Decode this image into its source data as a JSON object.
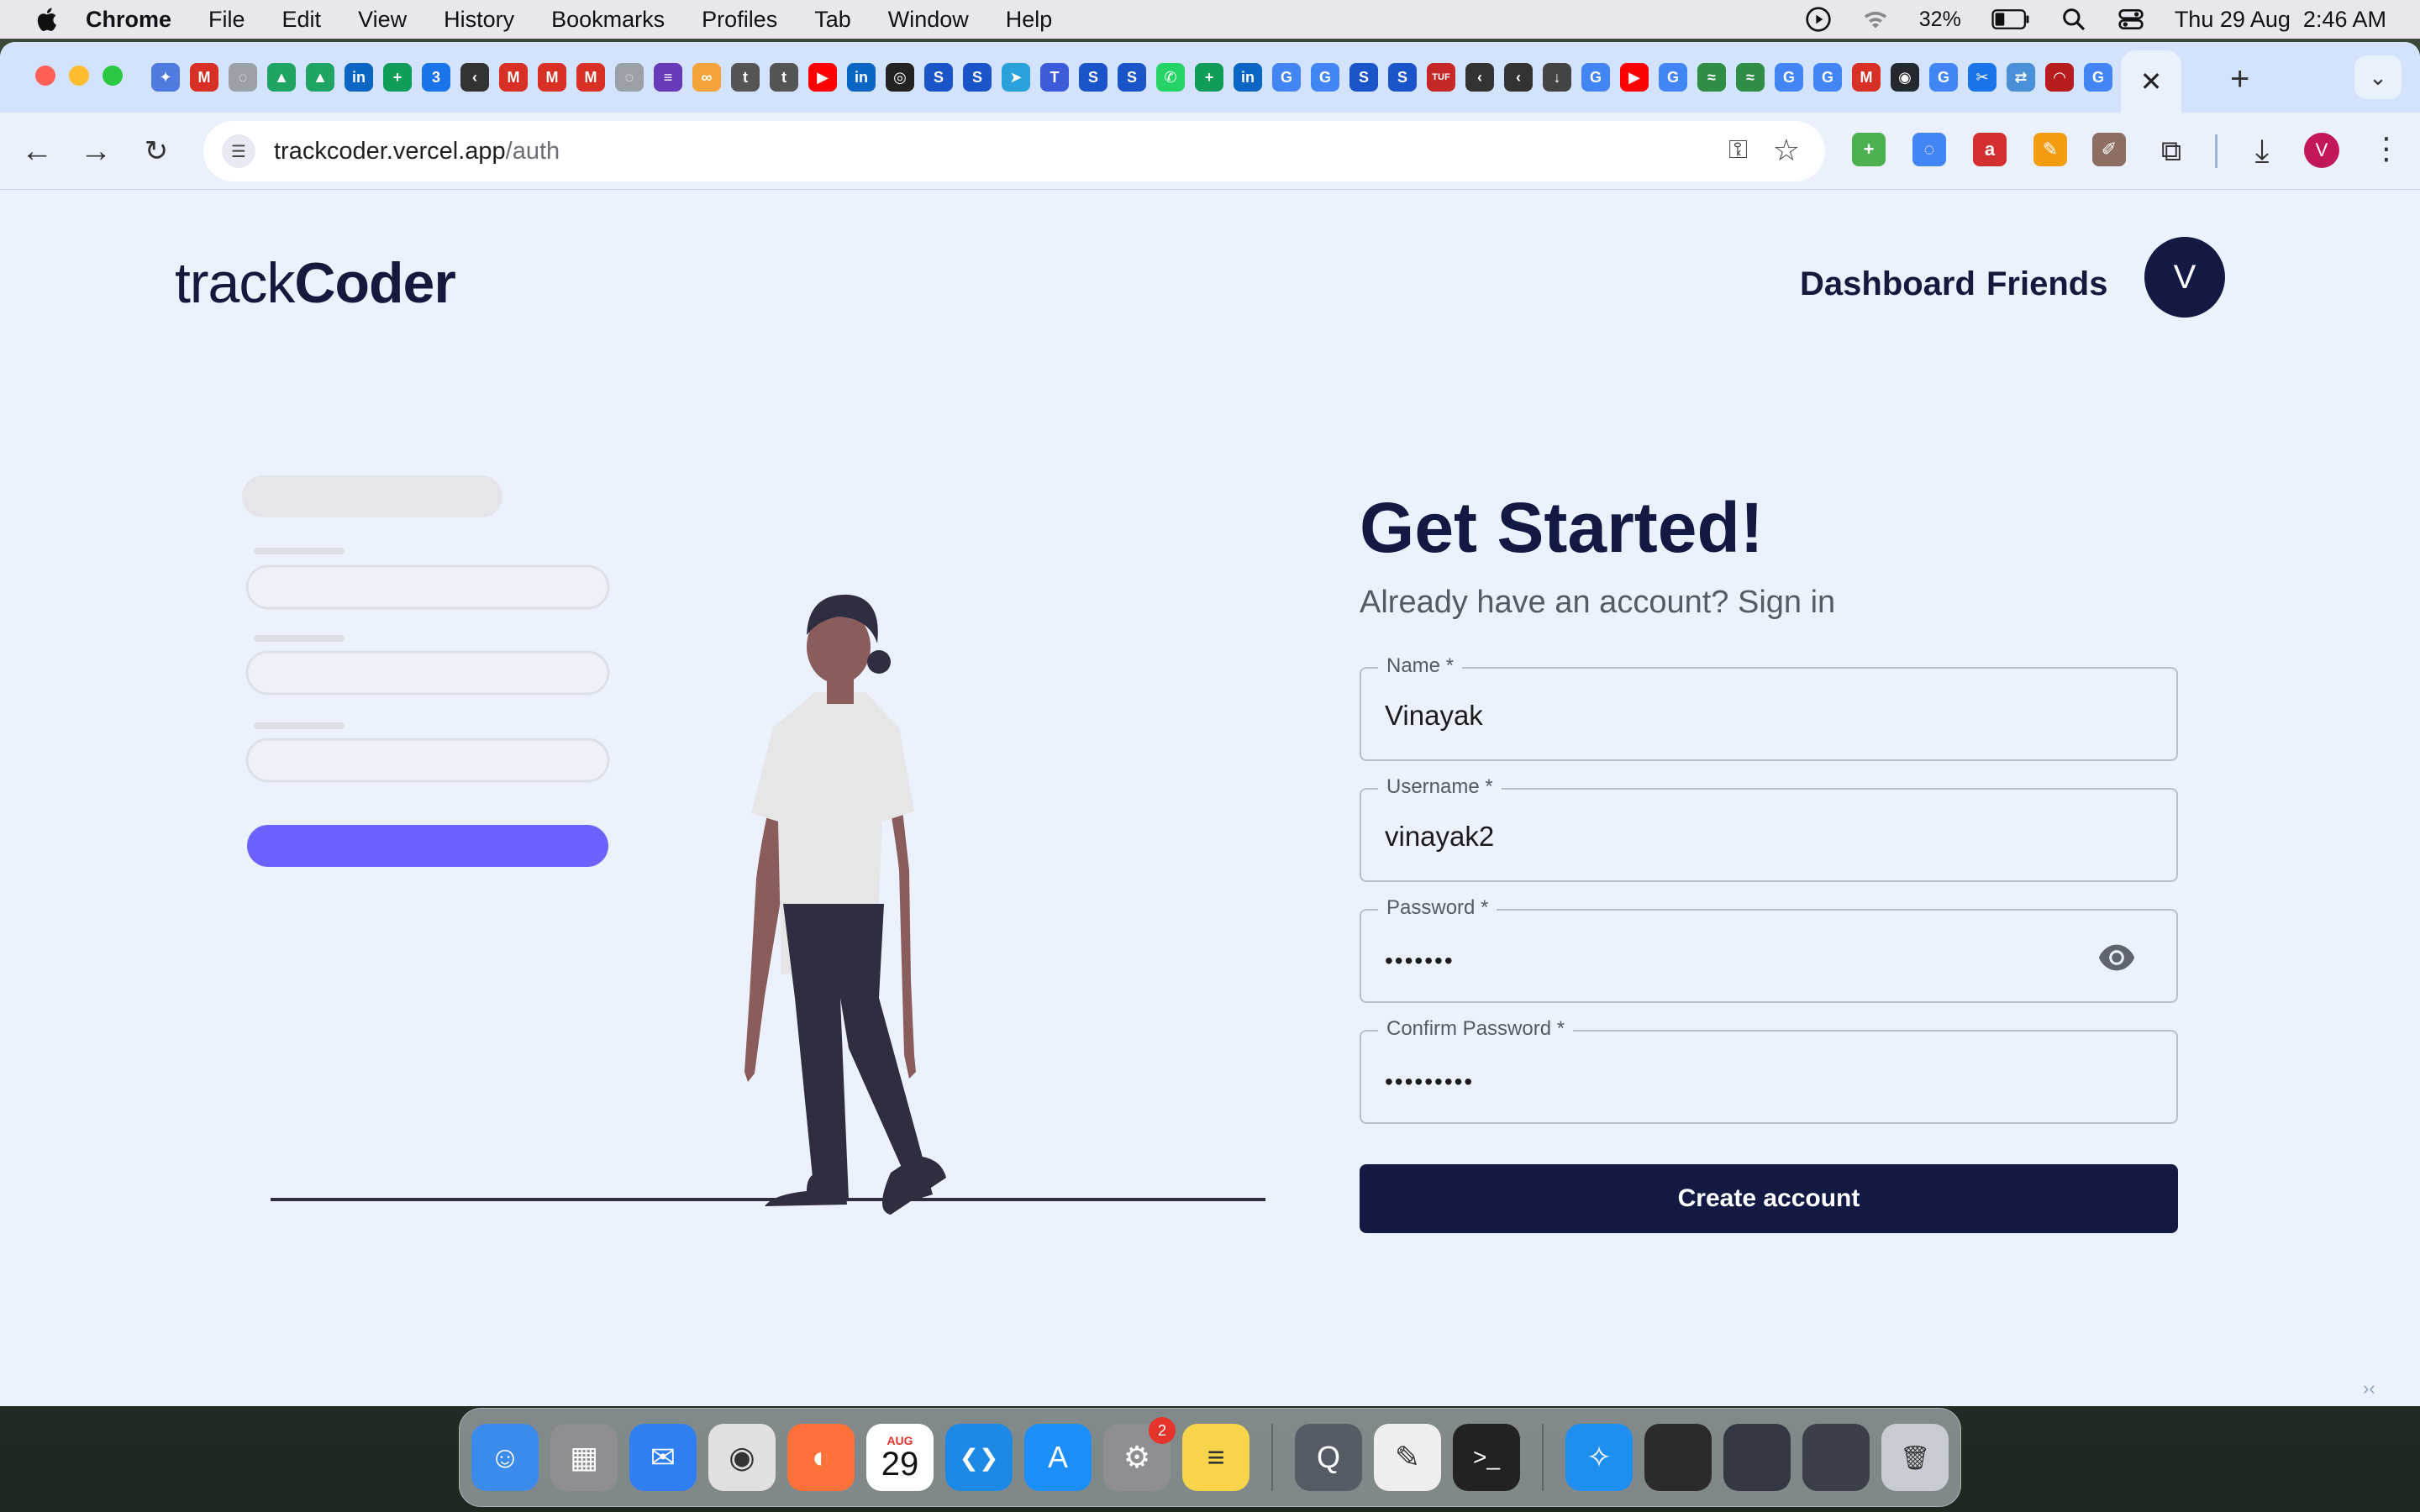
{
  "menubar": {
    "app": "Chrome",
    "items": [
      "File",
      "Edit",
      "View",
      "History",
      "Bookmarks",
      "Profiles",
      "Tab",
      "Window",
      "Help"
    ],
    "battery": "32%",
    "datetime": "Thu 29 Aug  2:46 AM"
  },
  "browser": {
    "url_host": "trackcoder.vercel.app",
    "url_path": "/auth",
    "profile_initial": "V",
    "close_tab_glyph": "✕",
    "new_tab_glyph": "+"
  },
  "tab_favicons": [
    {
      "icon": "gemini-icon",
      "color": "#4f7be0",
      "glyph": "✦"
    },
    {
      "icon": "gmail-icon",
      "color": "#d93025",
      "glyph": "M"
    },
    {
      "icon": "site-icon",
      "color": "#9aa0a6",
      "glyph": "◌"
    },
    {
      "icon": "drive-icon",
      "color": "#1fa463",
      "glyph": "▲"
    },
    {
      "icon": "drive-icon",
      "color": "#1fa463",
      "glyph": "▲"
    },
    {
      "icon": "linkedin-icon",
      "color": "#0a66c2",
      "glyph": "in"
    },
    {
      "icon": "sheets-icon",
      "color": "#0f9d58",
      "glyph": "+"
    },
    {
      "icon": "app-3-icon",
      "color": "#1a73e8",
      "glyph": "3"
    },
    {
      "icon": "leetcode-icon",
      "color": "#333333",
      "glyph": "‹"
    },
    {
      "icon": "gmail-icon",
      "color": "#d93025",
      "glyph": "M"
    },
    {
      "icon": "gmail-icon",
      "color": "#d93025",
      "glyph": "M"
    },
    {
      "icon": "gmail-icon",
      "color": "#d93025",
      "glyph": "M"
    },
    {
      "icon": "site-icon",
      "color": "#9aa0a6",
      "glyph": "◌"
    },
    {
      "icon": "forms-icon",
      "color": "#673ab7",
      "glyph": "≡"
    },
    {
      "icon": "site-icon",
      "color": "#f2a33a",
      "glyph": "∞"
    },
    {
      "icon": "tcs-icon",
      "color": "#555555",
      "glyph": "t"
    },
    {
      "icon": "tcs-icon",
      "color": "#555555",
      "glyph": "t"
    },
    {
      "icon": "youtube-icon",
      "color": "#ff0000",
      "glyph": "▶"
    },
    {
      "icon": "linkedin-icon",
      "color": "#0a66c2",
      "glyph": "in"
    },
    {
      "icon": "chatgpt-icon",
      "color": "#222222",
      "glyph": "◎"
    },
    {
      "icon": "scaler-icon",
      "color": "#1a54c9",
      "glyph": "S"
    },
    {
      "icon": "scaler-icon",
      "color": "#1a54c9",
      "glyph": "S"
    },
    {
      "icon": "telegram-icon",
      "color": "#2aa1da",
      "glyph": "➤"
    },
    {
      "icon": "tfs-icon",
      "color": "#3b5bdb",
      "glyph": "T"
    },
    {
      "icon": "scaler-icon",
      "color": "#1a54c9",
      "glyph": "S"
    },
    {
      "icon": "scaler-icon",
      "color": "#1a54c9",
      "glyph": "S"
    },
    {
      "icon": "whatsapp-icon",
      "color": "#25d366",
      "glyph": "✆"
    },
    {
      "icon": "sheets-icon",
      "color": "#0f9d58",
      "glyph": "+"
    },
    {
      "icon": "linkedin-icon",
      "color": "#0a66c2",
      "glyph": "in"
    },
    {
      "icon": "google-icon",
      "color": "#4285f4",
      "glyph": "G"
    },
    {
      "icon": "google-icon",
      "color": "#4285f4",
      "glyph": "G"
    },
    {
      "icon": "scaler-icon",
      "color": "#1a54c9",
      "glyph": "S"
    },
    {
      "icon": "scaler-icon",
      "color": "#1a54c9",
      "glyph": "S"
    },
    {
      "icon": "tuf-icon",
      "color": "#c62828",
      "glyph": "TUF"
    },
    {
      "icon": "leetcode-icon",
      "color": "#333333",
      "glyph": "‹"
    },
    {
      "icon": "leetcode-icon",
      "color": "#333333",
      "glyph": "‹"
    },
    {
      "icon": "download-icon",
      "color": "#444444",
      "glyph": "↓"
    },
    {
      "icon": "google-icon",
      "color": "#4285f4",
      "glyph": "G"
    },
    {
      "icon": "youtube-icon",
      "color": "#ff0000",
      "glyph": "▶"
    },
    {
      "icon": "google-icon",
      "color": "#4285f4",
      "glyph": "G"
    },
    {
      "icon": "gfg-icon",
      "color": "#2f8d46",
      "glyph": "≈"
    },
    {
      "icon": "gfg-icon",
      "color": "#2f8d46",
      "glyph": "≈"
    },
    {
      "icon": "google-icon",
      "color": "#4285f4",
      "glyph": "G"
    },
    {
      "icon": "google-icon",
      "color": "#4285f4",
      "glyph": "G"
    },
    {
      "icon": "gmail-icon",
      "color": "#d93025",
      "glyph": "M"
    },
    {
      "icon": "github-icon",
      "color": "#24292f",
      "glyph": "◉"
    },
    {
      "icon": "google-icon",
      "color": "#4285f4",
      "glyph": "G"
    },
    {
      "icon": "site-icon",
      "color": "#1a73e8",
      "glyph": "✂"
    },
    {
      "icon": "site-icon",
      "color": "#4a90d9",
      "glyph": "⇄"
    },
    {
      "icon": "site-icon",
      "color": "#b71c1c",
      "glyph": "◠"
    },
    {
      "icon": "google-icon",
      "color": "#4285f4",
      "glyph": "G"
    },
    {
      "icon": "google-icon",
      "color": "#4285f4",
      "glyph": "G"
    }
  ],
  "extensions": [
    {
      "icon": "extension-green-icon",
      "color": "#4caf50",
      "glyph": "+"
    },
    {
      "icon": "extension-ring-icon",
      "color": "#4285f4",
      "glyph": "◌"
    },
    {
      "icon": "extension-red-icon",
      "color": "#d32f2f",
      "glyph": "a"
    },
    {
      "icon": "extension-wand-icon",
      "color": "#f39c12",
      "glyph": "✎"
    },
    {
      "icon": "extension-pen-icon",
      "color": "#8d6e63",
      "glyph": "✐"
    }
  ],
  "page": {
    "logo_light": "track",
    "logo_bold": "Coder",
    "nav": {
      "dashboard": "Dashboard",
      "friends": "Friends"
    },
    "avatar_initial": "V",
    "heading": "Get Started!",
    "subheading_prefix": "Already have an account? ",
    "signin": "Sign in",
    "fields": {
      "name": {
        "label": "Name *",
        "value": "Vinayak"
      },
      "username": {
        "label": "Username *",
        "value": "vinayak2"
      },
      "password": {
        "label": "Password *",
        "value": "•••••••"
      },
      "confirm": {
        "label": "Confirm Password *",
        "value": "•••••••••"
      }
    },
    "submit": "Create account",
    "colors": {
      "primary": "#121a44",
      "background": "#ebf2fe",
      "accent": "#6c63ff"
    }
  },
  "dock": {
    "apps": [
      {
        "name": "finder",
        "color": "#3b8bea",
        "glyph": "☺"
      },
      {
        "name": "launchpad",
        "color": "#8e8e93",
        "glyph": "▦"
      },
      {
        "name": "mail",
        "color": "#2f7ff0",
        "glyph": "✉"
      },
      {
        "name": "chrome",
        "color": "#e0e0e0",
        "glyph": "◉"
      },
      {
        "name": "firefox",
        "color": "#ff7139",
        "glyph": "◐"
      },
      {
        "name": "calendar",
        "color": "#ffffff",
        "glyph": ""
      },
      {
        "name": "vscode",
        "color": "#1e88e5",
        "glyph": "❮❯"
      },
      {
        "name": "app-store",
        "color": "#1c8ef9",
        "glyph": "A"
      },
      {
        "name": "system-settings",
        "color": "#8e8e93",
        "glyph": "⚙"
      },
      {
        "name": "notes",
        "color": "#f7d44a",
        "glyph": "≡"
      }
    ],
    "apps_right": [
      {
        "name": "quicktime",
        "color": "#555c66",
        "glyph": "Q"
      },
      {
        "name": "textedit",
        "color": "#eeeeee",
        "glyph": "✎"
      },
      {
        "name": "terminal",
        "color": "#222222",
        "glyph": ">_"
      }
    ],
    "apps_far": [
      {
        "name": "safari",
        "color": "#1f8ef1",
        "glyph": "✧"
      },
      {
        "name": "window-1",
        "color": "#2b2b2b",
        "glyph": ""
      },
      {
        "name": "window-2",
        "color": "#333844",
        "glyph": ""
      },
      {
        "name": "window-3",
        "color": "#3a3f4a",
        "glyph": ""
      },
      {
        "name": "trash",
        "color": "#c7ccd4",
        "glyph": "🗑"
      }
    ],
    "calendar_month": "AUG",
    "calendar_day": "29",
    "settings_badge": "2"
  }
}
